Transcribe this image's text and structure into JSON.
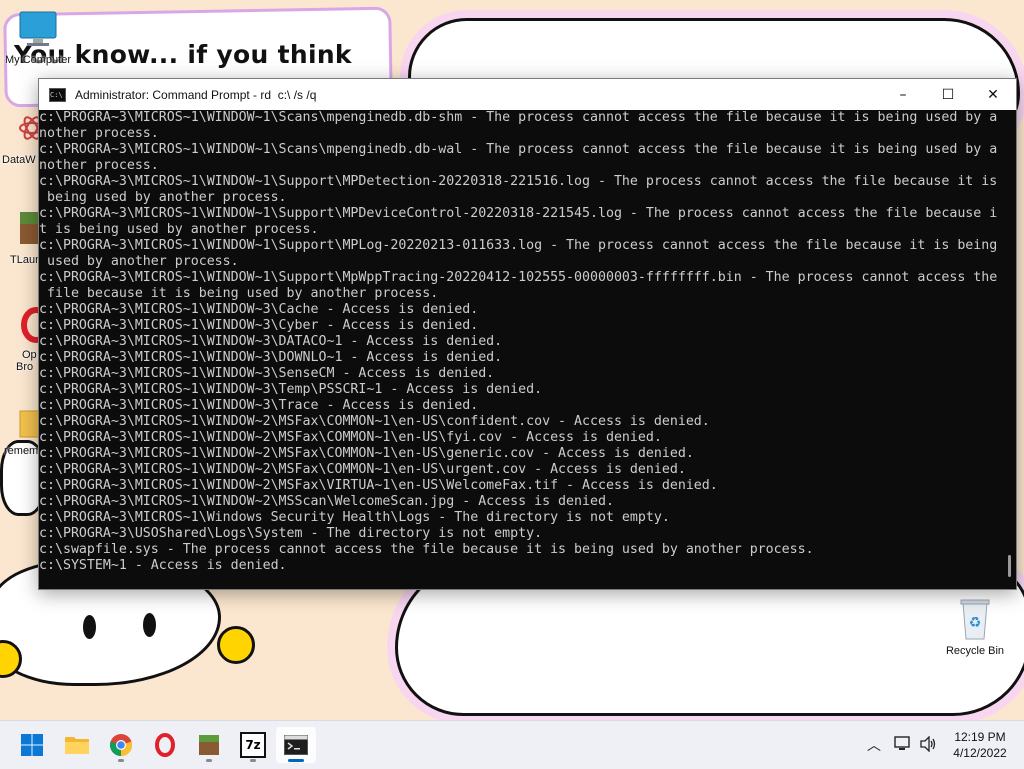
{
  "desktop": {
    "wallpaper_text": "You know... if you think",
    "icons": [
      {
        "label": "My Computer",
        "icon": "monitor-icon"
      },
      {
        "label": "DataW",
        "icon": "atom-icon"
      },
      {
        "label": "TLaun",
        "icon": "minecraft-launcher-icon"
      },
      {
        "label": "Op",
        "icon": "opera-icon"
      },
      {
        "label": "Bro",
        "icon": "opera-icon"
      },
      {
        "label": "remem",
        "icon": "folder-icon"
      },
      {
        "label": "Recycle Bin",
        "icon": "recycle-bin-icon"
      }
    ]
  },
  "window": {
    "title": "Administrator: Command Prompt - rd  c:\\ /s /q",
    "minimize": "–",
    "maximize": "☐",
    "close": "✕"
  },
  "console": {
    "lines": [
      "c:\\PROGRA~3\\MICROS~1\\WINDOW~1\\Scans\\mpenginedb.db-shm - The process cannot access the file because it is being used by a",
      "nother process.",
      "c:\\PROGRA~3\\MICROS~1\\WINDOW~1\\Scans\\mpenginedb.db-wal - The process cannot access the file because it is being used by a",
      "nother process.",
      "c:\\PROGRA~3\\MICROS~1\\WINDOW~1\\Support\\MPDetection-20220318-221516.log - The process cannot access the file because it is",
      " being used by another process.",
      "c:\\PROGRA~3\\MICROS~1\\WINDOW~1\\Support\\MPDeviceControl-20220318-221545.log - The process cannot access the file because i",
      "t is being used by another process.",
      "c:\\PROGRA~3\\MICROS~1\\WINDOW~1\\Support\\MPLog-20220213-011633.log - The process cannot access the file because it is being",
      " used by another process.",
      "c:\\PROGRA~3\\MICROS~1\\WINDOW~1\\Support\\MpWppTracing-20220412-102555-00000003-ffffffff.bin - The process cannot access the",
      " file because it is being used by another process.",
      "c:\\PROGRA~3\\MICROS~1\\WINDOW~3\\Cache - Access is denied.",
      "c:\\PROGRA~3\\MICROS~1\\WINDOW~3\\Cyber - Access is denied.",
      "c:\\PROGRA~3\\MICROS~1\\WINDOW~3\\DATACO~1 - Access is denied.",
      "c:\\PROGRA~3\\MICROS~1\\WINDOW~3\\DOWNLO~1 - Access is denied.",
      "c:\\PROGRA~3\\MICROS~1\\WINDOW~3\\SenseCM - Access is denied.",
      "c:\\PROGRA~3\\MICROS~1\\WINDOW~3\\Temp\\PSSCRI~1 - Access is denied.",
      "c:\\PROGRA~3\\MICROS~1\\WINDOW~3\\Trace - Access is denied.",
      "c:\\PROGRA~3\\MICROS~1\\WINDOW~2\\MSFax\\COMMON~1\\en-US\\confident.cov - Access is denied.",
      "c:\\PROGRA~3\\MICROS~1\\WINDOW~2\\MSFax\\COMMON~1\\en-US\\fyi.cov - Access is denied.",
      "c:\\PROGRA~3\\MICROS~1\\WINDOW~2\\MSFax\\COMMON~1\\en-US\\generic.cov - Access is denied.",
      "c:\\PROGRA~3\\MICROS~1\\WINDOW~2\\MSFax\\COMMON~1\\en-US\\urgent.cov - Access is denied.",
      "c:\\PROGRA~3\\MICROS~1\\WINDOW~2\\MSFax\\VIRTUA~1\\en-US\\WelcomeFax.tif - Access is denied.",
      "c:\\PROGRA~3\\MICROS~1\\WINDOW~2\\MSScan\\WelcomeScan.jpg - Access is denied.",
      "c:\\PROGRA~3\\MICROS~1\\Windows Security Health\\Logs - The directory is not empty.",
      "c:\\PROGRA~3\\USOShared\\Logs\\System - The directory is not empty.",
      "c:\\swapfile.sys - The process cannot access the file because it is being used by another process.",
      "c:\\SYSTEM~1 - Access is denied."
    ]
  },
  "taskbar": {
    "apps": [
      {
        "name": "start",
        "icon": "windows-start-icon"
      },
      {
        "name": "file-explorer",
        "icon": "folder-icon"
      },
      {
        "name": "chrome",
        "icon": "chrome-icon"
      },
      {
        "name": "opera",
        "icon": "opera-icon"
      },
      {
        "name": "minecraft",
        "icon": "minecraft-icon"
      },
      {
        "name": "7zip",
        "icon": "7zip-icon",
        "text": "7z"
      },
      {
        "name": "command-prompt",
        "icon": "cmd-icon",
        "active": true
      }
    ],
    "tray": {
      "time": "12:19 PM",
      "date": "4/12/2022"
    }
  }
}
